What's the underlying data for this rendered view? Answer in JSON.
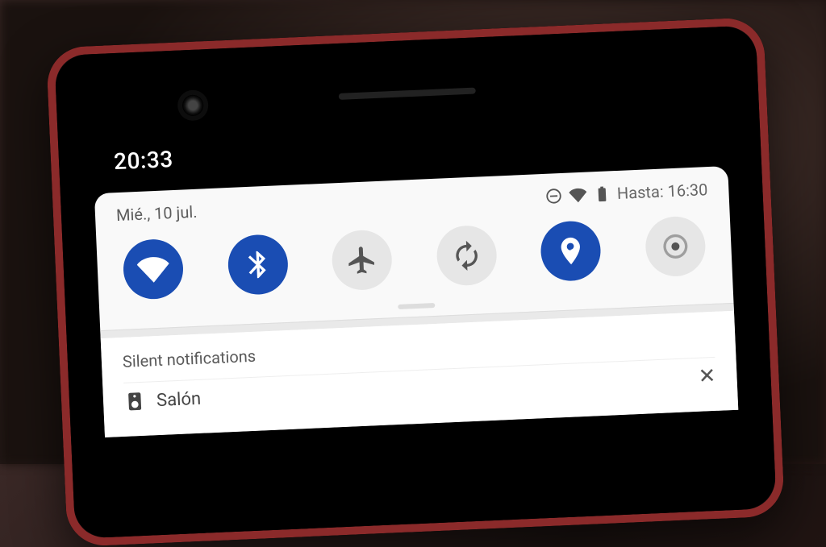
{
  "clock": "20:33",
  "panel": {
    "date": "Mié., 10 jul.",
    "status_label": "Hasta: 16:30"
  },
  "toggles": {
    "wifi": {
      "name": "wifi",
      "active": true
    },
    "bt": {
      "name": "bluetooth",
      "active": true
    },
    "plane": {
      "name": "airplane-mode",
      "active": false
    },
    "rotate": {
      "name": "auto-rotate",
      "active": false
    },
    "location": {
      "name": "location",
      "active": true
    },
    "cast": {
      "name": "cast",
      "active": false
    }
  },
  "colors": {
    "accent": "#1a4db3",
    "toggle_off": "#e6e6e6"
  },
  "silent_section": {
    "title": "Silent notifications"
  },
  "notification": {
    "title": "Salón"
  }
}
